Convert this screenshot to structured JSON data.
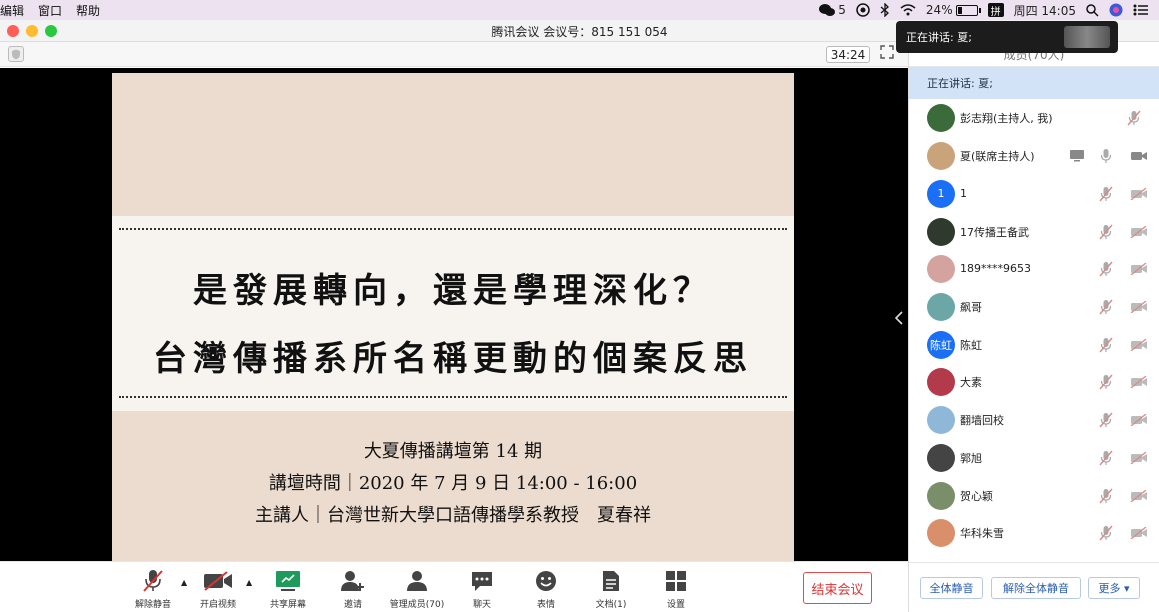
{
  "menubar": {
    "items": [
      "编辑",
      "窗口",
      "帮助"
    ],
    "wechat_count": "5",
    "battery": "24%",
    "ime": "拼",
    "clock": "周四 14:05"
  },
  "window": {
    "title": "腾讯会议 会议号：815 151 054"
  },
  "toolbar": {
    "timer": "34:24"
  },
  "toast": {
    "text": "正在讲话: 夏;"
  },
  "slide": {
    "title_line1": "是發展轉向，還是學理深化？",
    "title_line2": "台灣傳播系所名稱更動的個案反思",
    "info1": "大夏傳播講壇第 14 期",
    "info2": "講壇時間｜2020 年 7 月 9 日 14:00 - 16:00",
    "info3": "主講人｜台灣世新大學口語傳播學系教授　夏春祥"
  },
  "bottom_toolbar": {
    "unmute": "解除静音",
    "start_video": "开启视频",
    "share_screen": "共享屏幕",
    "invite": "邀请",
    "manage_members": "管理成员(70)",
    "chat": "聊天",
    "reactions": "表情",
    "docs": "文档(1)",
    "settings": "设置",
    "end_meeting": "结束会议"
  },
  "panel": {
    "header": "成员(70人)",
    "speaking": "正在讲话: 夏;",
    "members": [
      {
        "name": "彭志翔(主持人, 我)",
        "avatar_color": "#3b6b3b",
        "avatar_text": "",
        "camera": false,
        "host": true
      },
      {
        "name": "夏(联席主持人)",
        "avatar_color": "#c9a37a",
        "avatar_text": "",
        "camera": true,
        "host": false
      },
      {
        "name": "1",
        "avatar_color": "#1a6ff5",
        "avatar_text": "1",
        "camera": true,
        "host": false
      },
      {
        "name": "17传播王备武",
        "avatar_color": "#2f3a2f",
        "avatar_text": "",
        "camera": true,
        "host": false
      },
      {
        "name": "189****9653",
        "avatar_color": "#d4a3a0",
        "avatar_text": "",
        "camera": true,
        "host": false
      },
      {
        "name": "飙哥",
        "avatar_color": "#6aa7a6",
        "avatar_text": "",
        "camera": true,
        "host": false
      },
      {
        "name": "陈虹",
        "avatar_color": "#1a6ff5",
        "avatar_text": "陈虹",
        "camera": true,
        "host": false
      },
      {
        "name": "大素",
        "avatar_color": "#b33a4a",
        "avatar_text": "",
        "camera": true,
        "host": false
      },
      {
        "name": "翻墙回校",
        "avatar_color": "#8fb8d8",
        "avatar_text": "",
        "camera": true,
        "host": false
      },
      {
        "name": "郭旭",
        "avatar_color": "#444444",
        "avatar_text": "",
        "camera": true,
        "host": false
      },
      {
        "name": "贺心颖",
        "avatar_color": "#7a8e6a",
        "avatar_text": "",
        "camera": true,
        "host": false
      },
      {
        "name": "华科朱雪",
        "avatar_color": "#d98f6a",
        "avatar_text": "",
        "camera": true,
        "host": false
      }
    ],
    "mute_all": "全体静音",
    "unmute_all": "解除全体静音",
    "more": "更多 ▾"
  }
}
